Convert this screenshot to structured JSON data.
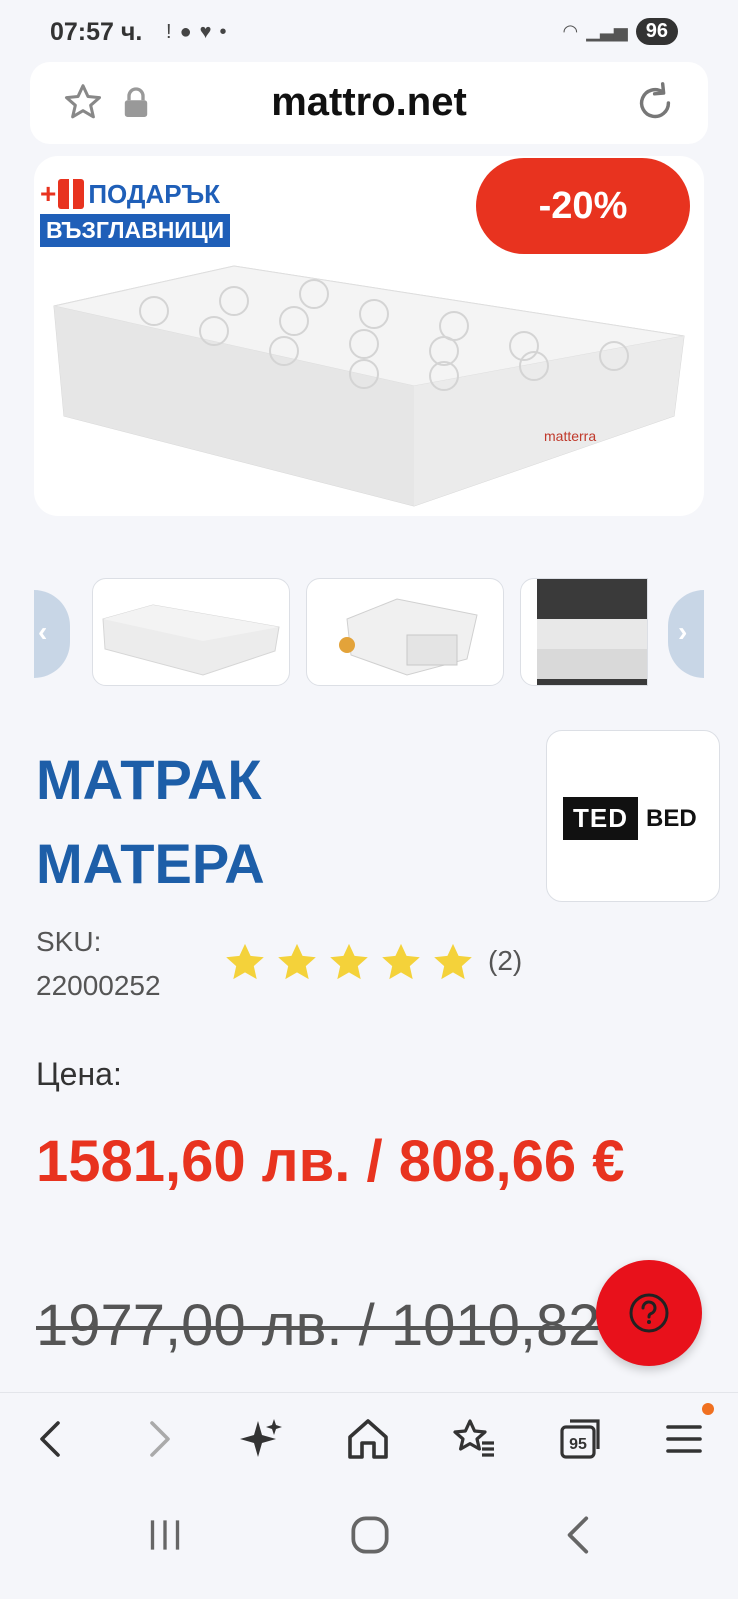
{
  "status_bar": {
    "time": "07:57 ч.",
    "battery": "96"
  },
  "url_bar": {
    "domain": "mattro.net"
  },
  "hero": {
    "gift_line1": "ПОДАРЪК",
    "gift_line2": "ВЪЗГЛАВНИЦИ",
    "discount": "-20%",
    "mattress_brand": "matterra"
  },
  "product": {
    "title": "МАТРАК МАТЕРА",
    "brand_logo_primary": "TED",
    "brand_logo_secondary": "BED",
    "sku_label": "SKU:",
    "sku_value": "22000252",
    "rating": 5,
    "reviews_count": "(2)",
    "price_label": "Цена:",
    "price_current": "1581,60 лв. / 808,66 €",
    "price_old": "1977,00 лв. / 1010,82 €"
  },
  "colors": {
    "accent_red": "#e8331f",
    "brand_blue": "#1d5ea8",
    "star_yellow": "#f4d23a"
  }
}
